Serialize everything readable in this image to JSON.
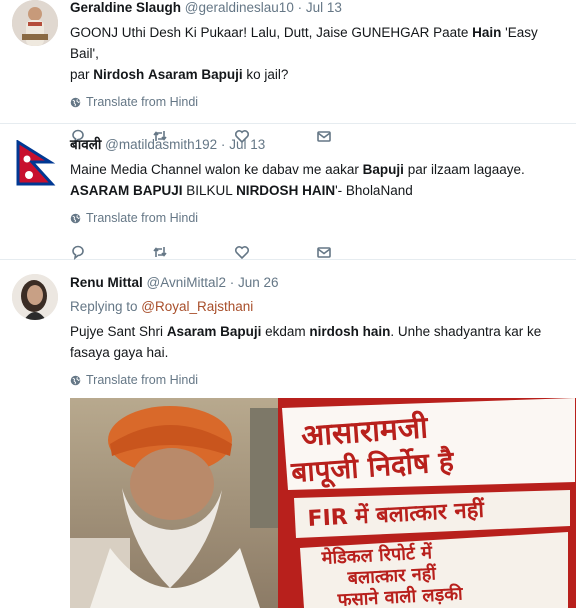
{
  "tweets": [
    {
      "name": "Geraldine Slaugh",
      "handle": "@geraldineslau10",
      "dot": "·",
      "date": "Jul 13",
      "line1": {
        "a": "GOONJ Uthi Desh Ki Pukaar! Lalu, Dutt, Jaise GUNEHGAR Paate ",
        "b": "Hain",
        "c": " 'Easy Bail',"
      },
      "line2": {
        "a": "par ",
        "b": "Nirdosh",
        "c": " ",
        "d": "Asaram",
        "e": " ",
        "f": "Bapuji",
        "g": " ko jail?"
      },
      "translate": "Translate from Hindi"
    },
    {
      "name": "बावली",
      "handle": "@matildasmith192",
      "dot": "·",
      "date": "Jul 13",
      "line1": {
        "a": "Maine Media Channel walon ke dabav me aakar ",
        "b": "Bapuji",
        "c": " par ilzaam lagaaye."
      },
      "line2": {
        "a": "ASARAM",
        "b": " ",
        "c": "BAPUJI",
        "d": " BILKUL ",
        "e": "NIRDOSH",
        "f": " ",
        "g": "HAIN",
        "h": "'- BholaNand"
      },
      "translate": "Translate from Hindi"
    },
    {
      "name": "Renu Mittal",
      "handle": "@AvniMittal2",
      "dot": "·",
      "date": "Jun 26",
      "replying_prefix": "Replying to ",
      "replying_to": "@Royal_Rajsthani",
      "line1": {
        "a": "Pujye Sant Shri ",
        "b": "Asaram Bapuji",
        "c": " ekdam ",
        "d": "nirdosh hain",
        "e": ". Unhe shadyantra kar ke"
      },
      "line2": {
        "a": "fasaya gaya hai."
      },
      "translate": "Translate from Hindi",
      "poster_lines": [
        "आसारामजी",
        "बापूजी निर्दोष है",
        "FIR में बलात्कार नहीं",
        "मेडिकल रिपोर्ट में",
        "बलात्कार नहीं",
        "फसाने वाली लड़की"
      ]
    }
  ],
  "colors": {
    "link": "#a84f2b",
    "muted": "#657786",
    "poster_red": "#b8201c"
  },
  "icons": [
    "globe-icon",
    "reply-icon",
    "retweet-icon",
    "like-icon",
    "message-icon"
  ]
}
